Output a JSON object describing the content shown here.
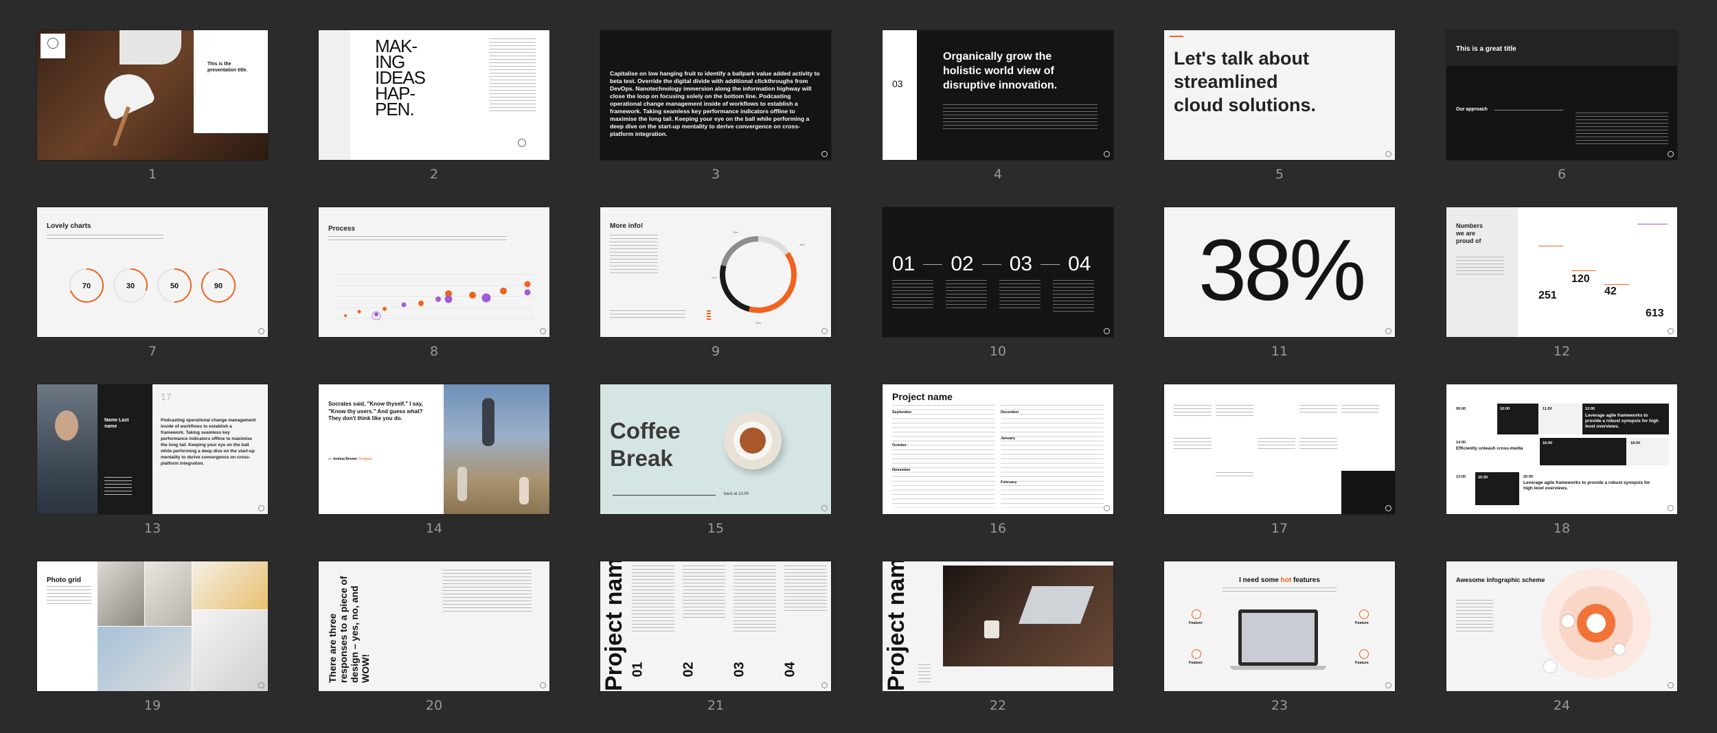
{
  "grid_labels": [
    "1",
    "2",
    "3",
    "4",
    "5",
    "6",
    "7",
    "8",
    "9",
    "10",
    "11",
    "12",
    "13",
    "14",
    "15",
    "16",
    "17",
    "18",
    "19",
    "20",
    "21",
    "22",
    "23",
    "24"
  ],
  "s1": {
    "title": "This is the presentation title."
  },
  "s2": {
    "big": "MAK-\nING\nIDEAS\nHAP-\nPEN."
  },
  "s3": {
    "body": "Capitalise on low hanging fruit to identify a ballpark value added activity to beta test. Override the digital divide with additional clickthroughs from DevOps. Nanotechnology immersion along the information highway will close the loop on focusing solely on the bottom line. Podcasting operational change management inside of workflows to establish a framework. Taking seamless key performance indicators offline to maximise the long tail. Keeping your eye on the ball while performing a deep dive on the start-up mentality to derive convergence on cross-platform integration."
  },
  "s4": {
    "number": "03",
    "title": "Organically grow the holistic world view of disruptive innovation."
  },
  "s5": {
    "title": "Let's talk about streamlined cloud solutions."
  },
  "s6": {
    "title": "This is a great title",
    "sub": "Our approach"
  },
  "s7": {
    "title": "Lovely charts",
    "gauges": [
      {
        "value": "70",
        "pct": 0.7
      },
      {
        "value": "30",
        "pct": 0.3
      },
      {
        "value": "50",
        "pct": 0.5
      },
      {
        "value": "90",
        "pct": 0.9
      }
    ]
  },
  "s8": {
    "title": "Process"
  },
  "s9": {
    "title": "More info!",
    "labels": [
      "15%",
      "39%",
      "21%",
      "25%"
    ],
    "chart_data": {
      "type": "pie",
      "values": [
        15,
        39,
        25,
        21
      ],
      "labels": [
        "15%",
        "39%",
        "25%",
        "21%"
      ]
    },
    "colors": [
      "#dcdcdc",
      "#f0621e",
      "#1a1a1a",
      "#8c8c8c"
    ]
  },
  "s10": {
    "steps": [
      "01",
      "02",
      "03",
      "04"
    ]
  },
  "s11": {
    "value": "38%"
  },
  "s12": {
    "title": "Numbers we are proud of",
    "values": [
      "251",
      "120",
      "42",
      "613"
    ]
  },
  "s13": {
    "number": "17",
    "name": "Name Last name",
    "body": "Podcasting operational change management inside of workflows to establish a framework. Taking seamless key performance indicators offline to maximise the long tail. Keeping your eye on the ball while performing a deep dive on the start-up mentality to derive convergence on cross-platform integration."
  },
  "s14": {
    "quote": "Socrates said, \"Know thyself.\" I say, \"Know thy users.\" And guess what? They don't think like you do.",
    "author": "— Joshua Brewer",
    "role": "Designer"
  },
  "s15": {
    "title": "Coffee Break",
    "back": "back at 13.00"
  },
  "s16": {
    "title": "Project name",
    "months_left": [
      "September",
      "October",
      "November"
    ],
    "months_right": [
      "December",
      "January",
      "February"
    ]
  },
  "s18": {
    "times": [
      "09:00",
      "10:00",
      "11:00",
      "12:00",
      "14:00",
      "16:00",
      "18:00",
      "13:00",
      "15:30",
      "20:00"
    ],
    "head1": "Leverage agile frameworks to provide a robust synopsis for high level overviews.",
    "head2": "Efficiently unleash cross-media",
    "head3": "Leverage agile frameworks to provide a robust synopsis for high level overviews."
  },
  "s19": {
    "title": "Photo grid"
  },
  "s20": {
    "vertical": "There are three responses to a piece of design – yes, no, and WOW!"
  },
  "s21": {
    "vertical": "Project nam",
    "nums": [
      "01",
      "02",
      "03",
      "04"
    ]
  },
  "s22": {
    "vertical": "Project nam"
  },
  "s23": {
    "title_pre": "I need some ",
    "title_hot": "hot",
    "title_post": " features",
    "feature": "Feature"
  },
  "s24": {
    "title": "Awesome infographic scheme"
  }
}
